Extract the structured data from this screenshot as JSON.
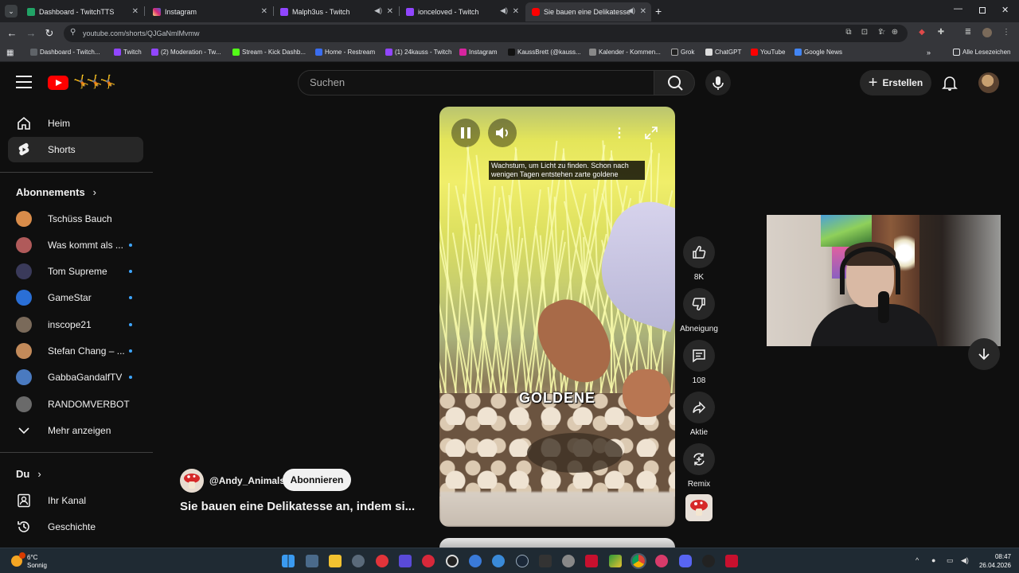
{
  "browser": {
    "tabs": [
      {
        "label": "Dashboard - TwitchTTS",
        "color": "#21a366"
      },
      {
        "label": "Instagram",
        "color": "#d6249f"
      },
      {
        "label": "Malph3us - Twitch",
        "color": "#9146ff"
      },
      {
        "label": "ionceloved - Twitch",
        "color": "#9146ff"
      },
      {
        "label": "Sie bauen eine Delikatesse",
        "color": "#ff0000"
      }
    ],
    "url": "youtube.com/shorts/QJGaNmlMvmw",
    "bookmarks": [
      "Dashboard - Twitch...",
      "Twitch",
      "(2) Moderation - Tw...",
      "Stream - Kick Dashb...",
      "Home - Restream",
      "(1) 24kauss - Twitch",
      "Instagram",
      "KaussBrett (@kauss...",
      "Kalender - Kommen...",
      "Grok",
      "ChatGPT",
      "YouTube",
      "Google News"
    ],
    "all_bookmarks": "Alle Lesezeichen"
  },
  "masthead": {
    "search_placeholder": "Suchen",
    "create_label": "Erstellen"
  },
  "sidebar": {
    "home": "Heim",
    "shorts": "Shorts",
    "subscriptions_heading": "Abonnements",
    "subscriptions": [
      {
        "name": "Tschüss Bauch",
        "dot": false,
        "color": "#d98c4a"
      },
      {
        "name": "Was kommt als ...",
        "dot": true,
        "color": "#b05a5a"
      },
      {
        "name": "Tom Supreme",
        "dot": true,
        "color": "#3a3a5a"
      },
      {
        "name": "GameStar",
        "dot": true,
        "color": "#2a6fd6"
      },
      {
        "name": "inscope21",
        "dot": true,
        "color": "#7a6a5a"
      },
      {
        "name": "Stefan Chang – ...",
        "dot": true,
        "color": "#c28a5a"
      },
      {
        "name": "GabbaGandalfTV",
        "dot": true,
        "color": "#4a7ac0"
      },
      {
        "name": "RANDOMVERBOT",
        "dot": false,
        "color": "#6a6a6a"
      }
    ],
    "show_more": "Mehr anzeigen",
    "you_heading": "Du",
    "your_channel": "Ihr Kanal",
    "history": "Geschichte"
  },
  "short": {
    "caption": "Wachstum, um Licht zu finden. Schon nach wenigen Tagen entstehen zarte goldene",
    "overlay_word": "GOLDENE",
    "channel": "@Andy_Animals",
    "subscribe_label": "Abonnieren",
    "title": "Sie bauen eine Delikatesse an, indem si..."
  },
  "actions": {
    "likes": "8K",
    "dislike": "Abneigung",
    "comments": "108",
    "share": "Aktie",
    "remix": "Remix"
  },
  "taskbar": {
    "temperature": "6°C",
    "weather": "Sonnig",
    "time": "08:47",
    "date": "26.04.2026"
  }
}
